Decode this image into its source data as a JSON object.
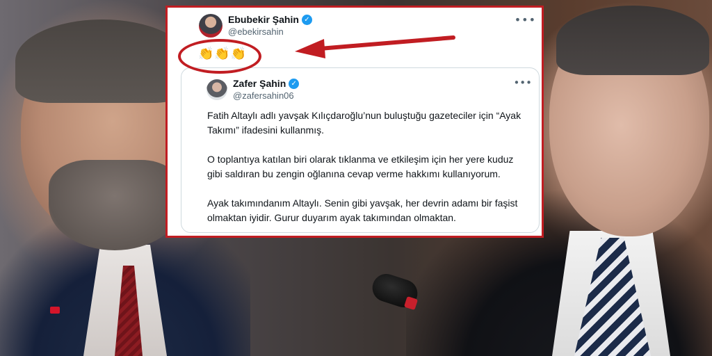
{
  "post": {
    "author_name": "Ebubekir Şahin",
    "author_handle": "@ebekirsahin",
    "reaction": "👏👏👏",
    "more_icon": "more-dots-icon"
  },
  "quoted_post": {
    "author_name": "Zafer Şahin",
    "author_handle": "@zafersahin06",
    "paragraphs": [
      "Fatih Altaylı adlı yavşak Kılıçdaroğlu’nun buluştuğu gazeteciler için “Ayak Takımı” ifadesini kullanmış.",
      "O toplantıya katılan biri olarak tıklanma ve etkileşim için her yere kuduz gibi saldıran bu zengin oğlanına cevap verme hakkımı kullanıyorum.",
      "Ayak takımındanım Altaylı. Senin gibi yavşak, her devrin adamı bir faşist olmaktan iyidir. Gurur duyarım ayak takımından olmaktan."
    ]
  },
  "colors": {
    "highlight_red": "#c11d22",
    "verified_blue": "#1d9bf0"
  }
}
